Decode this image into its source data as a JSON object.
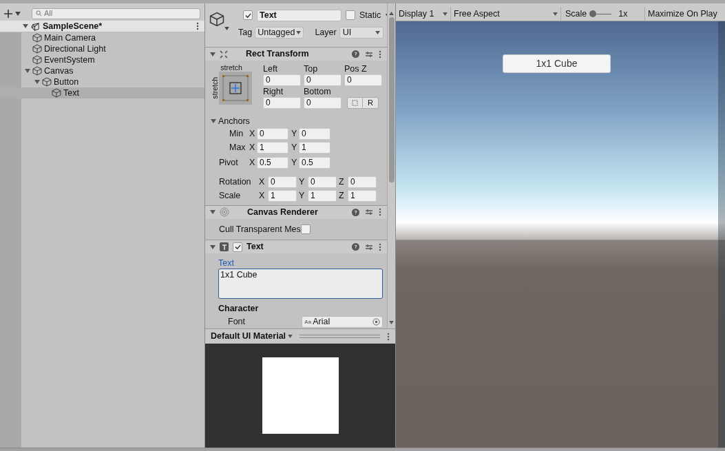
{
  "hierarchy": {
    "search": {
      "placeholder": "All"
    },
    "scene": {
      "name": "SampleScene*",
      "expanded": true,
      "children": [
        {
          "name": "Main Camera",
          "selected": false
        },
        {
          "name": "Directional Light",
          "selected": false
        },
        {
          "name": "EventSystem",
          "selected": false
        },
        {
          "name": "Canvas",
          "selected": false,
          "expanded": true,
          "children": [
            {
              "name": "Button",
              "selected": false,
              "expanded": true,
              "children": [
                {
                  "name": "Text",
                  "selected": true
                }
              ]
            }
          ]
        }
      ]
    }
  },
  "inspector": {
    "header": {
      "active": true,
      "name": "Text",
      "static_checked": false,
      "static_label": "Static",
      "tag_label": "Tag",
      "tag": "Untagged",
      "layer_label": "Layer",
      "layer": "UI"
    },
    "rect_transform": {
      "title": "Rect Transform",
      "expanded": true,
      "preset_top": "stretch",
      "preset_side": "stretch",
      "fields": [
        {
          "label": "Left",
          "value": "0"
        },
        {
          "label": "Top",
          "value": "0"
        },
        {
          "label": "Pos Z",
          "value": "0"
        },
        {
          "label": "Right",
          "value": "0"
        },
        {
          "label": "Bottom",
          "value": "0"
        }
      ],
      "raw_button": "R",
      "anchors": {
        "label": "Anchors",
        "expanded": true
      },
      "vectors": [
        {
          "label": "Min",
          "indent": true,
          "axes": [
            {
              "axis": "X",
              "value": "0"
            },
            {
              "axis": "Y",
              "value": "0"
            }
          ]
        },
        {
          "label": "Max",
          "indent": true,
          "axes": [
            {
              "axis": "X",
              "value": "1"
            },
            {
              "axis": "Y",
              "value": "1"
            }
          ]
        },
        {
          "label": "Pivot",
          "indent": false,
          "axes": [
            {
              "axis": "X",
              "value": "0.5"
            },
            {
              "axis": "Y",
              "value": "0.5"
            }
          ]
        }
      ],
      "transform": [
        {
          "label": "Rotation",
          "axes": [
            {
              "axis": "X",
              "value": "0"
            },
            {
              "axis": "Y",
              "value": "0"
            },
            {
              "axis": "Z",
              "value": "0"
            }
          ]
        },
        {
          "label": "Scale",
          "axes": [
            {
              "axis": "X",
              "value": "1"
            },
            {
              "axis": "Y",
              "value": "1"
            },
            {
              "axis": "Z",
              "value": "1"
            }
          ]
        }
      ]
    },
    "canvas_renderer": {
      "title": "Canvas Renderer",
      "expanded": true,
      "property": "Cull Transparent Mes",
      "checked": false
    },
    "text_component": {
      "title": "Text",
      "enabled": true,
      "expanded": true,
      "text_label": "Text",
      "text_value": "1x1 Cube",
      "section": "Character",
      "font_label": "Font",
      "font_icon": "Aa",
      "font_value": "Arial"
    },
    "material": {
      "name": "Default UI Material"
    }
  },
  "game": {
    "display": "Display 1",
    "aspect": "Free Aspect",
    "scale_label": "Scale",
    "scale": {
      "level": 0.1
    },
    "scale_value": "1x",
    "maximize": "Maximize On Play",
    "ui_button": "1x1 Cube"
  }
}
